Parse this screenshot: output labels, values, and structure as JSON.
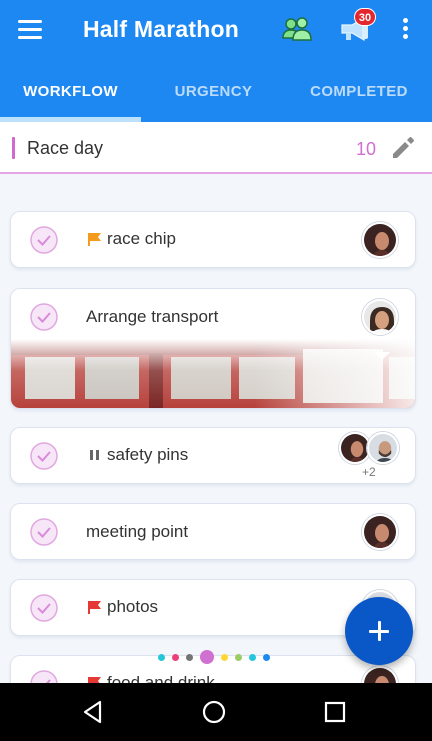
{
  "app": {
    "title": "Half Marathon",
    "notification_count": "30",
    "accent_color": "#1e88f2",
    "fab_color": "#0a57c7"
  },
  "tabs": [
    {
      "label": "WORKFLOW",
      "active": true
    },
    {
      "label": "URGENCY",
      "active": false
    },
    {
      "label": "COMPLETED",
      "active": false
    }
  ],
  "section": {
    "name": "Race day",
    "count": "10",
    "color": "#d06ad0"
  },
  "tasks": [
    {
      "label": "race chip",
      "marker": "orange-flag-icon",
      "marker_color": "#f49b1d",
      "avatars": [
        "avatar-woman-dark-hair"
      ],
      "extra_count": ""
    },
    {
      "label": "Arrange transport",
      "marker": "",
      "avatars": [
        "avatar-woman-smiling"
      ],
      "has_photo": true,
      "extra_count": ""
    },
    {
      "label": "safety pins",
      "marker": "pause-icon",
      "marker_color": "#666666",
      "avatars": [
        "avatar-woman-dark-hair",
        "avatar-man-bearded"
      ],
      "extra_count": "+2"
    },
    {
      "label": "meeting point",
      "marker": "",
      "avatars": [
        "avatar-woman-dark-hair"
      ],
      "extra_count": ""
    },
    {
      "label": "photos",
      "marker": "red-flag-icon",
      "marker_color": "#e53935",
      "avatars": [
        "avatar-man-bearded"
      ],
      "extra_count": ""
    },
    {
      "label": "food and drink",
      "marker": "red-flag-icon",
      "marker_color": "#e53935",
      "avatars": [
        "avatar-woman-dark-hair"
      ],
      "extra_count": ""
    }
  ],
  "page_indicator": {
    "current_index": 3,
    "colors": [
      "#26c6da",
      "#ec407a",
      "#757575",
      "#d070d0",
      "#fdd835",
      "#9ccc65",
      "#26c6da",
      "#1e88f2"
    ]
  },
  "system_nav": [
    "back-icon",
    "home-icon",
    "recents-icon"
  ]
}
